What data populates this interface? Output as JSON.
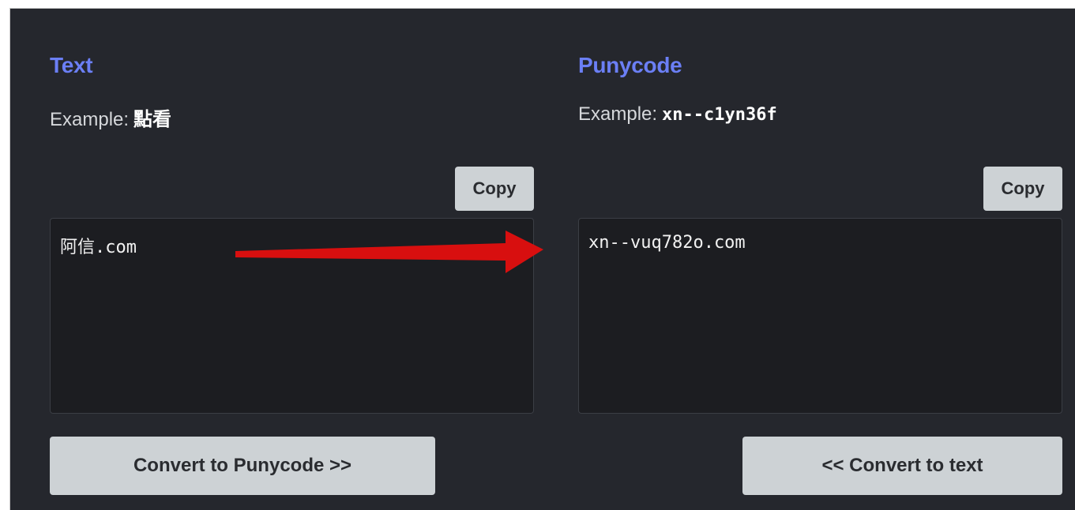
{
  "text_panel": {
    "heading": "Text",
    "example_label": "Example:",
    "example_value": "點看",
    "copy_label": "Copy",
    "input_value": "阿信.com",
    "convert_label": "Convert to Punycode >>"
  },
  "punycode_panel": {
    "heading": "Punycode",
    "example_label": "Example:",
    "example_value": "xn--c1yn36f",
    "copy_label": "Copy",
    "output_value": "xn--vuq782o.com",
    "convert_label": "<< Convert to text"
  },
  "annotation": {
    "arrow_color": "#d80f0f",
    "icon": "red-arrow-annotation"
  },
  "colors": {
    "background": "#25272d",
    "heading": "#6b7ff5",
    "button": "#cdd2d5",
    "textbox": "#1c1d21"
  }
}
